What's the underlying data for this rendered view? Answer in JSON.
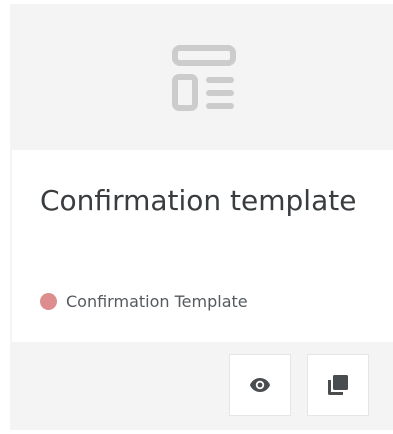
{
  "card": {
    "title": "Confirmation template",
    "type_label": "Confirmation Template",
    "type_color": "#dd8d8d",
    "thumbnail_icon": "template-layout-icon"
  },
  "actions": [
    {
      "icon": "eye-icon",
      "action": "preview"
    },
    {
      "icon": "copy-icon",
      "action": "duplicate"
    }
  ],
  "colors": {
    "card_background": "#f4f4f4",
    "body_background": "#ffffff",
    "title_text": "#3a3d40",
    "icon_gray": "#cccccc",
    "action_icon": "#4a4d50"
  }
}
